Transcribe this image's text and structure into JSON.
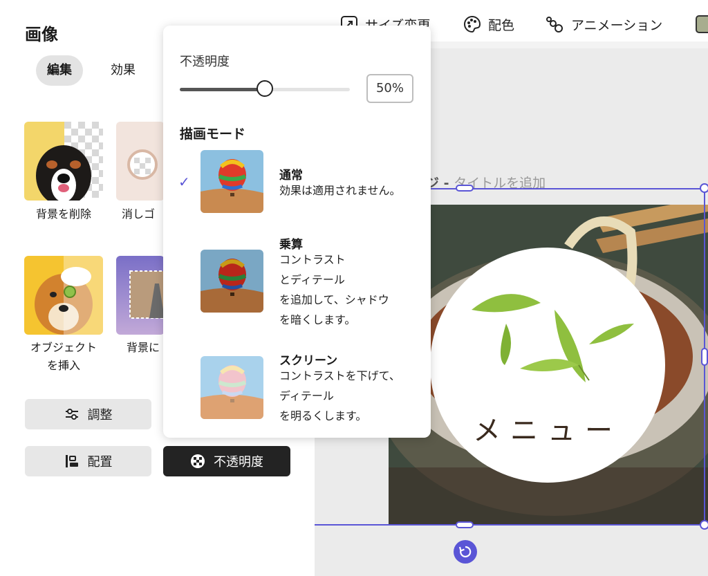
{
  "panel": {
    "title": "画像",
    "tabs": [
      {
        "label": "編集",
        "active": true
      },
      {
        "label": "効果",
        "active": false
      }
    ],
    "tiles": [
      {
        "label": "背景を削除",
        "icon": "dog-remove-bg-icon"
      },
      {
        "label": "消しゴ",
        "icon": "eraser-sunglasses-icon"
      },
      {
        "label": "オブジェクト\nを挿入",
        "icon": "shiba-insert-object-icon"
      },
      {
        "label": "背景に",
        "icon": "road-bg-icon"
      }
    ],
    "buttons": {
      "adjust": "調整",
      "arrange": "配置",
      "opacity": "不透明度"
    }
  },
  "toolbar": {
    "resize": "サイズ変更",
    "color": "配色",
    "animation": "アニメーション"
  },
  "popover": {
    "opacity_label": "不透明度",
    "opacity_value": "50%",
    "opacity_fraction": 0.5,
    "blend_title": "描画モード",
    "modes": [
      {
        "name": "通常",
        "desc": "効果は適用されません。",
        "selected": true
      },
      {
        "name": "乗算",
        "desc": "コントラスト\nとディテール\nを追加して、シャドウ\nを暗くします。",
        "selected": false
      },
      {
        "name": "スクリーン",
        "desc": "コントラストを下げて、\nディテール\nを明るくします。",
        "selected": false
      }
    ]
  },
  "canvas": {
    "title_prefix": "ジ - ",
    "title_placeholder": "タイトルを追加",
    "image_text": "メニュー"
  },
  "colors": {
    "accent": "#5a55d6",
    "dark_button": "#232323"
  }
}
